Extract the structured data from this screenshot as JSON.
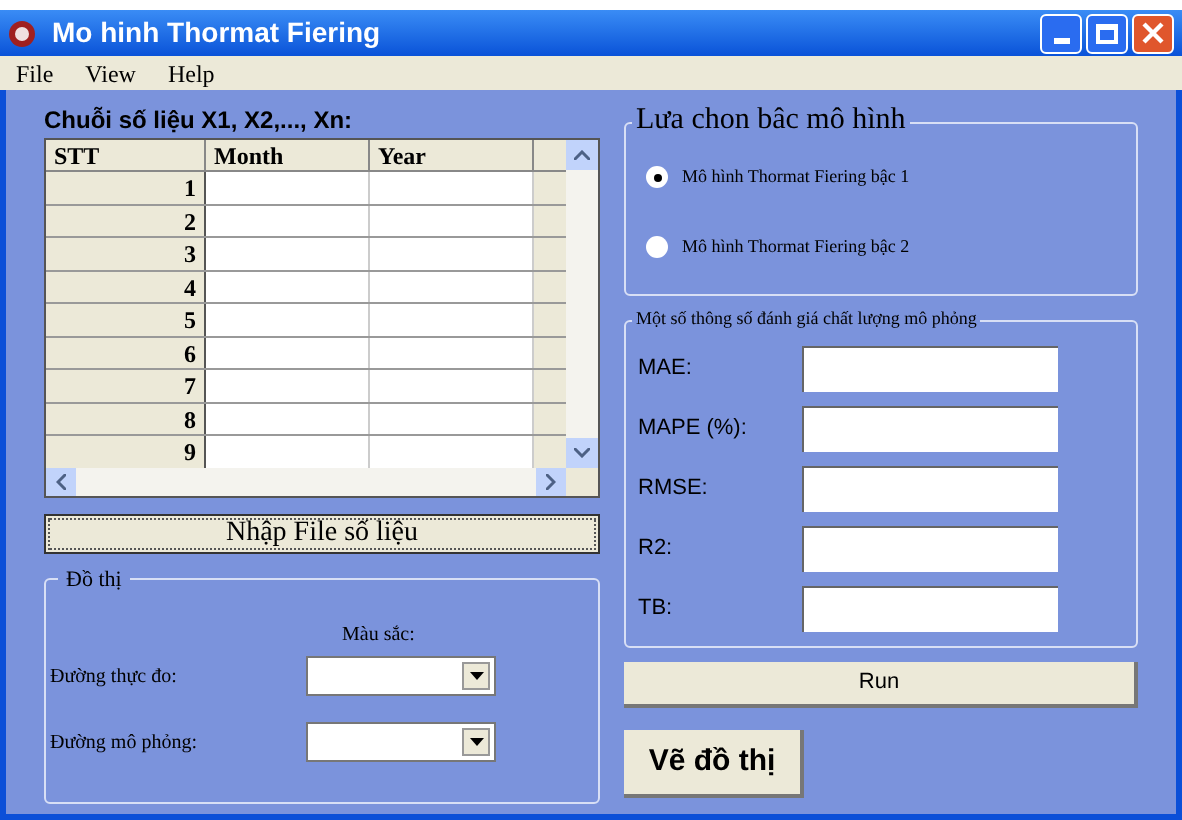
{
  "window": {
    "title": "Mo hinh Thormat Fiering"
  },
  "menu": [
    "File",
    "View",
    "Help"
  ],
  "series_panel": {
    "title": "Chuỗi số liệu X1, X2,..., Xn:",
    "columns": [
      "STT",
      "Month",
      "Year"
    ],
    "rows": [
      "1",
      "2",
      "3",
      "4",
      "5",
      "6",
      "7",
      "8",
      "9"
    ]
  },
  "import_button": "Nhập File số liệu",
  "chart_group": {
    "title": "Đồ thị",
    "color_label": "Màu sắc:",
    "lines": [
      {
        "label": "Đường thực đo:"
      },
      {
        "label": "Đường mô phỏng:"
      }
    ]
  },
  "model_group": {
    "title": "Lưa chon bâc mô hình",
    "options": [
      {
        "label": "Mô hình Thormat Fiering bậc 1",
        "selected": true
      },
      {
        "label": "Mô hình Thormat Fiering bậc 2",
        "selected": false
      }
    ]
  },
  "metrics_group": {
    "title": "Một số thông số đánh giá chất lượng mô phỏng",
    "fields": [
      "MAE:",
      "MAPE (%):",
      "RMSE:",
      "R2:",
      "TB:"
    ]
  },
  "run_button": "Run",
  "plot_button": "Vẽ đồ thị"
}
